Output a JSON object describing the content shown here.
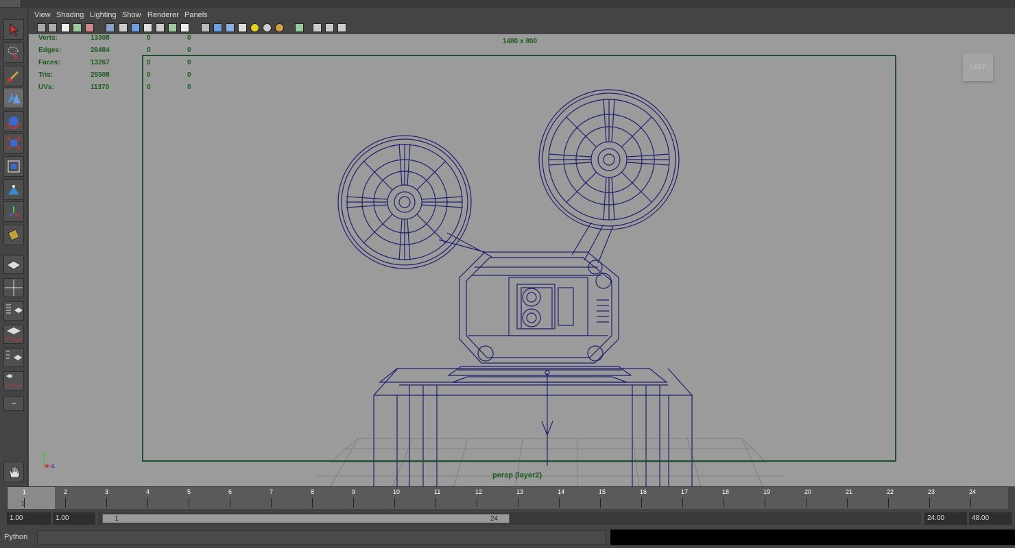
{
  "menu": [
    "View",
    "Shading",
    "Lighting",
    "Show",
    "Renderer",
    "Panels"
  ],
  "hud": {
    "rows": [
      {
        "label": "Verts:",
        "value": "13308",
        "a": "0",
        "b": "0"
      },
      {
        "label": "Edges:",
        "value": "26484",
        "a": "0",
        "b": "0"
      },
      {
        "label": "Faces:",
        "value": "13267",
        "a": "0",
        "b": "0"
      },
      {
        "label": "Tris:",
        "value": "25508",
        "a": "0",
        "b": "0"
      },
      {
        "label": "UVs:",
        "value": "11370",
        "a": "0",
        "b": "0"
      }
    ],
    "resolution": "1480 x 800",
    "camera_label": "persp (layer2)"
  },
  "viewcube_label": "LEFT",
  "axis": {
    "y": "y",
    "x": "x",
    "z": "z"
  },
  "timeline": {
    "ticks": [
      "1",
      "2",
      "3",
      "4",
      "5",
      "6",
      "7",
      "8",
      "9",
      "10",
      "11",
      "12",
      "13",
      "14",
      "15",
      "16",
      "17",
      "18",
      "19",
      "20",
      "21",
      "22",
      "23",
      "24"
    ],
    "current_frame": "1"
  },
  "range": {
    "start": "1.00",
    "anim_start": "1.00",
    "slider_start": "1",
    "slider_end": "24",
    "end": "24.00",
    "anim_end": "48.00"
  },
  "command": {
    "language": "Python"
  },
  "colors": {
    "wireframe": "#1e1e6e",
    "hud": "#1a5a1a",
    "viewport": "#9b9b9b"
  }
}
